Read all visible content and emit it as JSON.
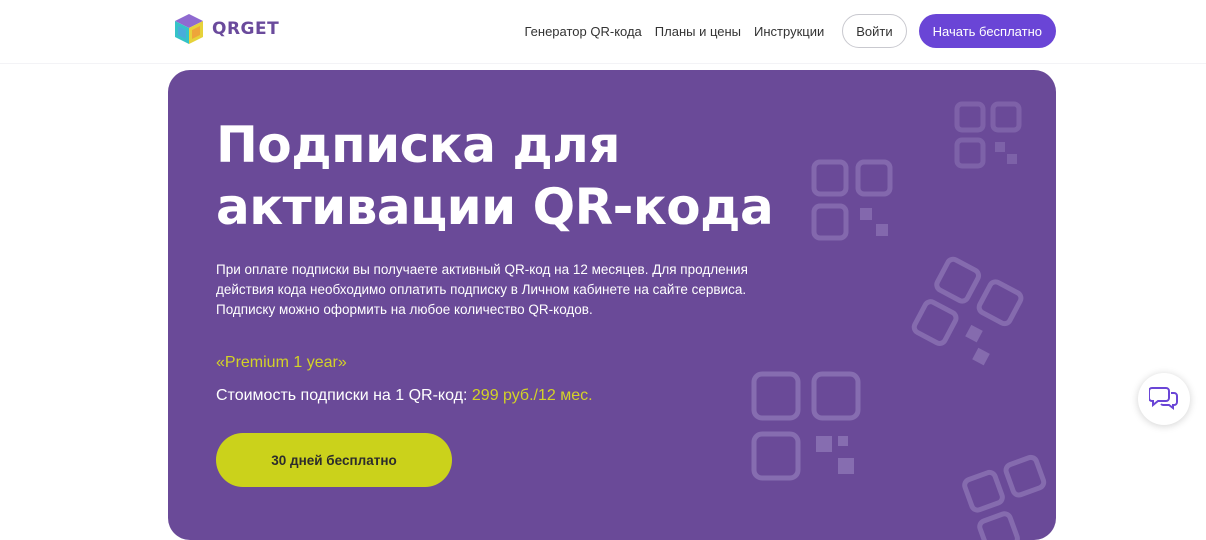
{
  "brand": {
    "name": "QRGET"
  },
  "nav": {
    "links": [
      "Генератор QR-кода",
      "Планы и цены",
      "Инструкции"
    ],
    "login_label": "Войти",
    "start_label": "Начать бесплатно"
  },
  "hero": {
    "title": "Подписка для активации QR-кода",
    "description": "При оплате подписки вы получаете активный QR-код на 12 месяцев. Для продления действия кода необходимо оплатить подписку в Личном кабинете на сайте сервиса. Подписку можно оформить на любое количество QR-кодов.",
    "plan_name": "«Premium 1 year»",
    "price_label": "Стоимость подписки на 1 QR-код:",
    "price_value": "299 руб./12 мес.",
    "cta_label": "30 дней бесплатно"
  },
  "colors": {
    "hero_bg": "#6a4a98",
    "accent": "#cbd21b",
    "primary_button": "#6a45d6"
  },
  "icons": [
    "qrget-logo-icon",
    "qr-code-icon",
    "chat-icon"
  ]
}
